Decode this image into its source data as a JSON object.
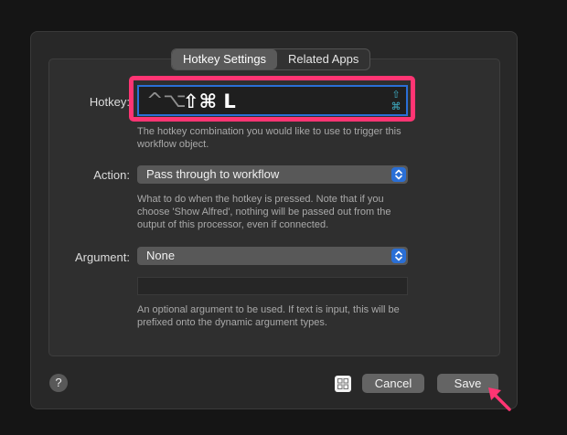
{
  "tabs": [
    {
      "label": "Hotkey Settings",
      "active": true
    },
    {
      "label": "Related Apps",
      "active": false
    }
  ],
  "hotkey": {
    "label": "Hotkey:",
    "dim_modifiers": "^⌥",
    "active_combo": "⇧⌘ L",
    "side_symbols": "⇧\n⌘",
    "help": "The hotkey combination you would like to use to trigger this workflow object.",
    "highlight_color": "#ff3573"
  },
  "action": {
    "label": "Action:",
    "value": "Pass through to workflow",
    "help": "What to do when the hotkey is pressed. Note that if you choose 'Show Alfred', nothing will be passed out from the output of this processor, even if connected."
  },
  "argument": {
    "label": "Argument:",
    "value": "None",
    "input_value": "",
    "help": "An optional argument to be used. If text is input, this will be prefixed onto the dynamic argument types."
  },
  "footer": {
    "help_button": "?",
    "grid_icon": "grid-icon",
    "cancel_label": "Cancel",
    "save_label": "Save"
  },
  "colors": {
    "accent": "#2a6fd6",
    "highlight": "#ff3573",
    "symbol": "#3fb2c9"
  }
}
